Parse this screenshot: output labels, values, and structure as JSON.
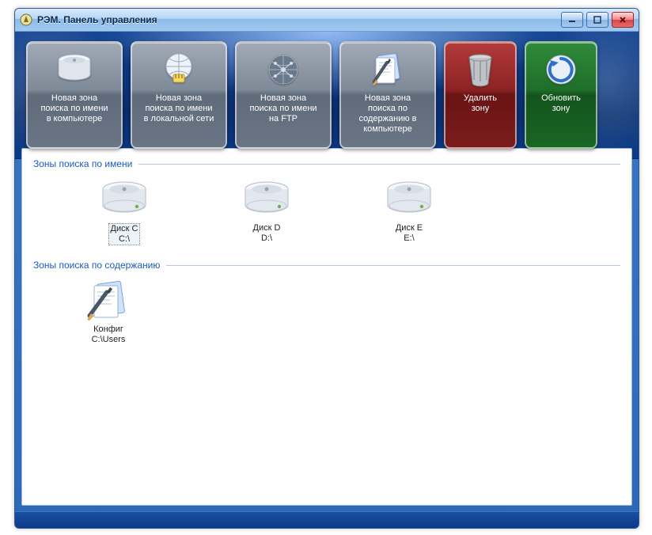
{
  "window": {
    "title": "РЭМ. Панель управления"
  },
  "toolbar": {
    "new_zone_computer": "Новая зона\nпоиска по имени\nв компьютере",
    "new_zone_lan": "Новая зона\nпоиска по имени\nв локальной сети",
    "new_zone_ftp": "Новая зона\nпоиска по имени\nна FTP",
    "new_zone_content": "Новая зона\nпоиска по\nсодержанию в\nкомпьютере",
    "delete_zone": "Удалить\nзону",
    "refresh_zone": "Обновить\nзону"
  },
  "sections": {
    "by_name": {
      "title": "Зоны поиска по имени",
      "items": [
        {
          "label": "Диск C\nC:\\",
          "selected": true
        },
        {
          "label": "Диск D\nD:\\",
          "selected": false
        },
        {
          "label": "Диск E\nE:\\",
          "selected": false
        }
      ]
    },
    "by_content": {
      "title": "Зоны поиска по содержанию",
      "items": [
        {
          "label": "Конфиг\nC:\\Users",
          "selected": false
        }
      ]
    }
  }
}
